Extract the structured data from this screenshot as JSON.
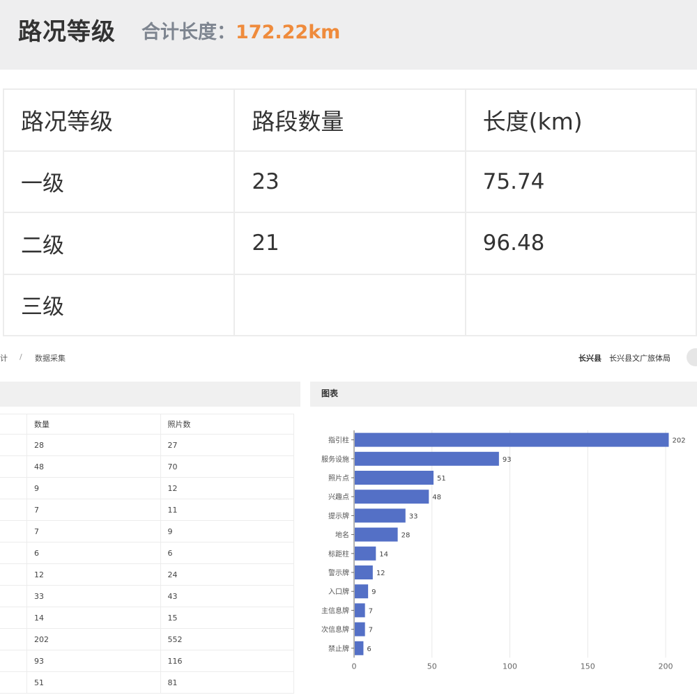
{
  "top": {
    "title": "路况等级",
    "total_label": "合计长度：",
    "total_value": "172.22km",
    "table": {
      "headers": [
        "路况等级",
        "路段数量",
        "长度(km)"
      ],
      "rows": [
        [
          "一级",
          "23",
          "75.74"
        ],
        [
          "二级",
          "21",
          "96.48"
        ],
        [
          "三级",
          "",
          ""
        ]
      ]
    }
  },
  "breadcrumb": {
    "item1": "计",
    "separator": "/",
    "item2": "数据采集"
  },
  "header_right": {
    "county": "长兴县",
    "org": "长兴县文广旅体局"
  },
  "data_table": {
    "headers": [
      "数量",
      "照片数"
    ],
    "rows": [
      [
        "28",
        "27"
      ],
      [
        "48",
        "70"
      ],
      [
        "9",
        "12"
      ],
      [
        "7",
        "11"
      ],
      [
        "7",
        "9"
      ],
      [
        "6",
        "6"
      ],
      [
        "12",
        "24"
      ],
      [
        "33",
        "43"
      ],
      [
        "14",
        "15"
      ],
      [
        "202",
        "552"
      ],
      [
        "93",
        "116"
      ],
      [
        "51",
        "81"
      ]
    ]
  },
  "chart_title": "图表",
  "chart_data": {
    "type": "bar",
    "orientation": "horizontal",
    "categories": [
      "指引柱",
      "服务设施",
      "照片点",
      "兴趣点",
      "提示牌",
      "地名",
      "标距柱",
      "警示牌",
      "入口牌",
      "主信息牌",
      "次信息牌",
      "禁止牌"
    ],
    "values": [
      202,
      93,
      51,
      48,
      33,
      28,
      14,
      12,
      9,
      7,
      7,
      6
    ],
    "xlim": [
      0,
      200
    ],
    "xticks": [
      0,
      50,
      100,
      150,
      200
    ],
    "grid": true,
    "bar_color": "#5470c6"
  }
}
